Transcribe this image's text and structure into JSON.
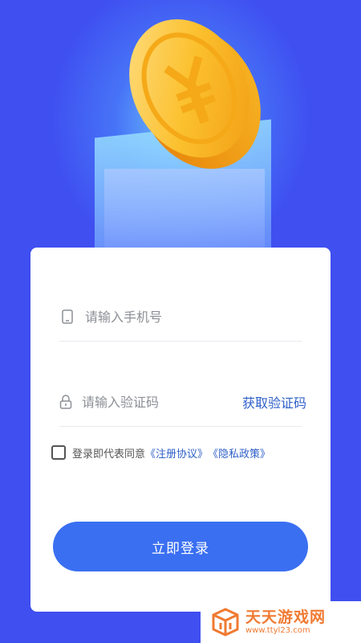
{
  "login": {
    "phone_placeholder": "请输入手机号",
    "code_placeholder": "请输入验证码",
    "get_code_label": "获取验证码",
    "agreement_prefix": "登录即代表同意",
    "agreement_link": "《注册协议》",
    "privacy_link": "《隐私政策》",
    "agreement_checked": false,
    "submit_label": "立即登录"
  },
  "watermark": {
    "title": "天天游戏网",
    "url": "www.ttyl23.com"
  },
  "icons": {
    "phone_field": "phone-icon",
    "code_field": "lock-icon",
    "hero": "yuan-coin-icon",
    "watermark": "box-logo-icon"
  },
  "colors": {
    "background": "#3f4ff0",
    "button": "#3a6ff2",
    "link": "#2e5fc8",
    "coin": "#f8b924",
    "watermark": "#f07a32"
  }
}
